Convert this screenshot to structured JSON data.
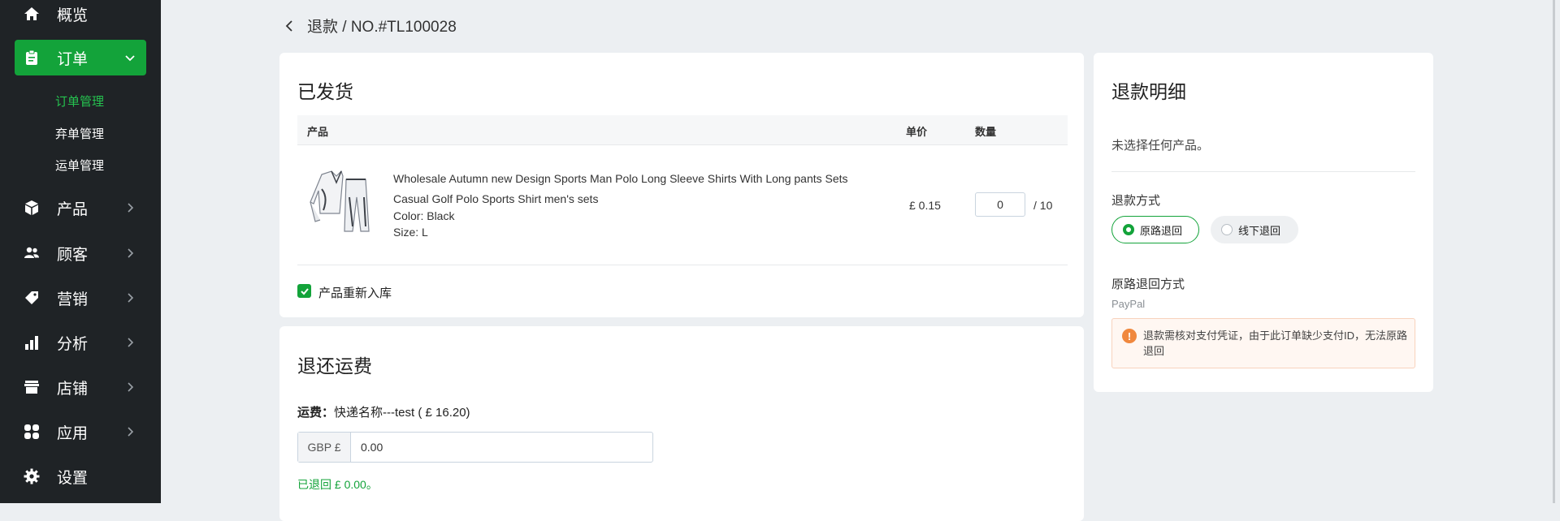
{
  "sidebar": {
    "items": [
      {
        "label": "概览",
        "icon": "home-icon"
      },
      {
        "label": "订单",
        "icon": "clipboard-icon"
      },
      {
        "label": "产品",
        "icon": "box-icon"
      },
      {
        "label": "顾客",
        "icon": "users-icon"
      },
      {
        "label": "营销",
        "icon": "tag-icon"
      },
      {
        "label": "分析",
        "icon": "bar-chart-icon"
      },
      {
        "label": "店铺",
        "icon": "store-icon"
      },
      {
        "label": "应用",
        "icon": "apps-icon"
      },
      {
        "label": "设置",
        "icon": "gear-icon"
      }
    ],
    "sub_items": [
      {
        "label": "订单管理"
      },
      {
        "label": "弃单管理"
      },
      {
        "label": "运单管理"
      }
    ],
    "active_color": "#13a33a"
  },
  "breadcrumb": {
    "text": "退款 / NO.#TL100028"
  },
  "shipped": {
    "title": "已发货",
    "columns": {
      "product": "产品",
      "unit_price": "单价",
      "quantity": "数量"
    },
    "product": {
      "name_line1": "Wholesale Autumn new Design Sports Man Polo Long Sleeve Shirts With Long pants Sets",
      "name_line2": "Casual Golf Polo Sports Shirt men's sets",
      "color": "Color: Black",
      "size": "Size: L",
      "price": "£ 0.15",
      "qty_value": "0",
      "qty_total": "/  10"
    },
    "restock_label": "产品重新入库",
    "restock_checked": true
  },
  "shipping_refund": {
    "title": "退还运费",
    "fee_label": "运费：",
    "fee_value": "快递名称---test ( £ 16.20)",
    "currency_prefix": "GBP £",
    "amount_value": "0.00",
    "refunded_text": "已退回  £ 0.00。"
  },
  "refund_detail": {
    "title": "退款明细",
    "empty_text": "未选择任何产品。",
    "method_label": "退款方式",
    "method_options": [
      "原路退回",
      "线下退回"
    ],
    "selected_method": "原路退回",
    "original_method_label": "原路退回方式",
    "payment_channel": "PayPal",
    "warning_text": "退款需核对支付凭证，由于此订单缺少支付ID，无法原路退回"
  }
}
